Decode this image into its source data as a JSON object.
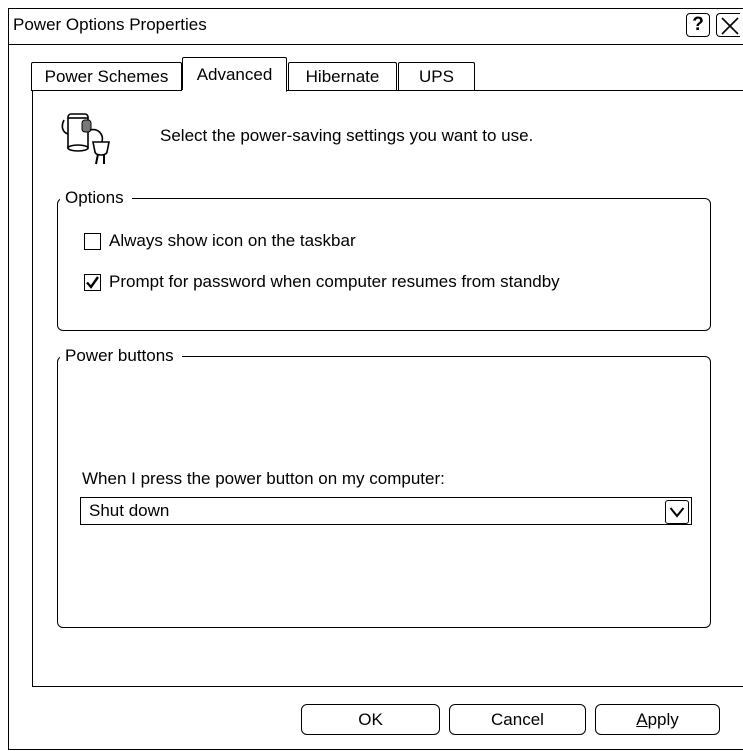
{
  "window": {
    "title": "Power Options Properties",
    "help_label": "?"
  },
  "tabs": [
    {
      "label": "Power Schemes",
      "active": false
    },
    {
      "label": "Advanced",
      "active": true
    },
    {
      "label": "Hibernate",
      "active": false
    },
    {
      "label": "UPS",
      "active": false
    }
  ],
  "intro_text": "Select the power-saving settings you want to use.",
  "options_group": {
    "legend": "Options",
    "items": [
      {
        "label": "Always show icon on the taskbar",
        "checked": false
      },
      {
        "label": "Prompt for password when computer resumes from standby",
        "checked": true
      }
    ]
  },
  "power_buttons_group": {
    "legend": "Power buttons",
    "prompt": "When I press the power button on my computer:",
    "selected_value": "Shut down"
  },
  "buttons": {
    "ok": "OK",
    "cancel": "Cancel",
    "apply_mnemonic": "A",
    "apply_rest": "pply"
  },
  "icons": {
    "help": "help-icon",
    "close": "close-icon",
    "power_plug": "power-plug-icon",
    "dropdown": "chevron-down-icon",
    "check": "checkmark-icon"
  }
}
